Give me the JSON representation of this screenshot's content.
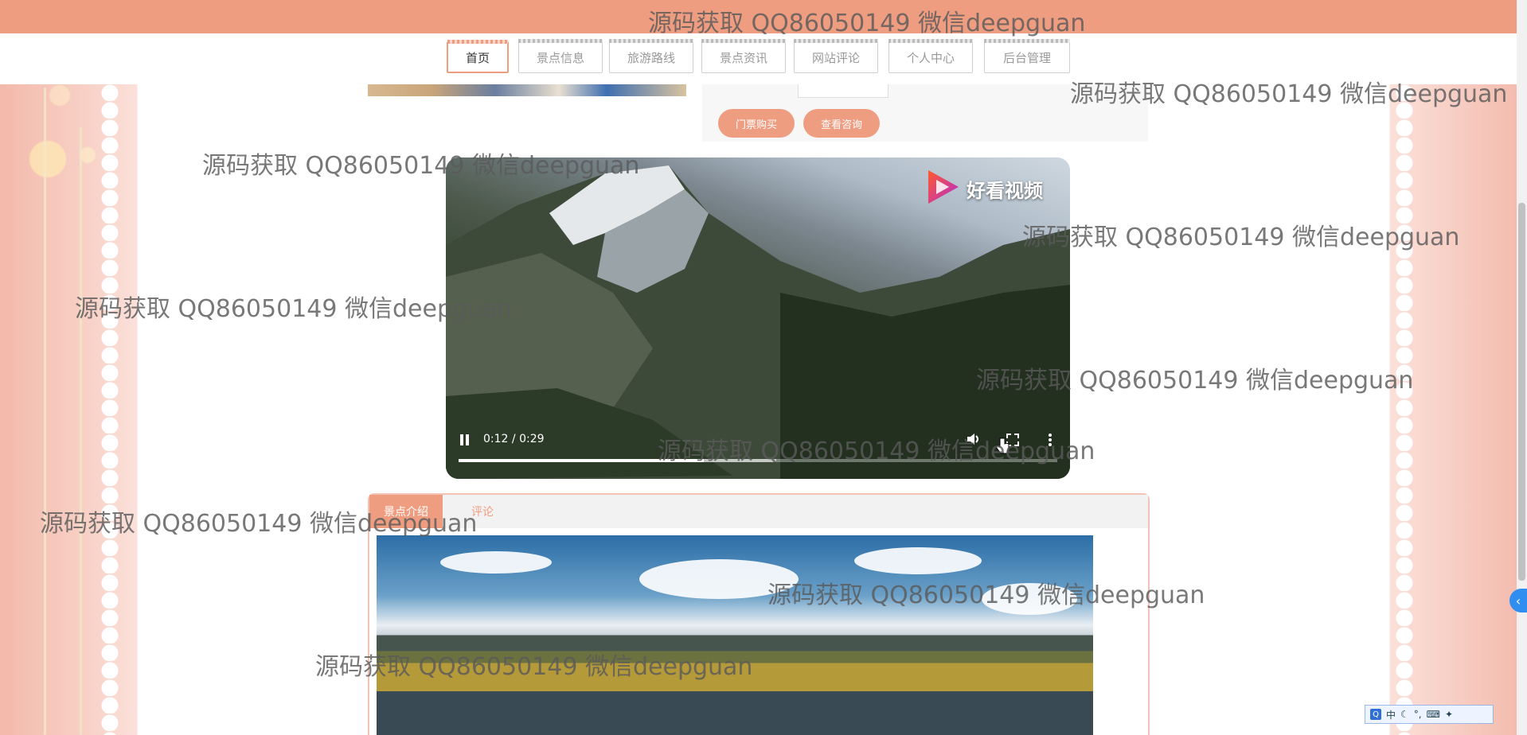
{
  "nav": {
    "items": [
      {
        "label": "首页",
        "active": true
      },
      {
        "label": "景点信息"
      },
      {
        "label": "旅游路线"
      },
      {
        "label": "景点资讯"
      },
      {
        "label": "网站评论"
      },
      {
        "label": "个人中心"
      },
      {
        "label": "后台管理"
      }
    ]
  },
  "detail": {
    "buy_button": "门票购买",
    "consult_button": "查看咨询"
  },
  "video": {
    "current_time": "0:12",
    "separator": "/",
    "duration": "0:29",
    "brand": "好看视频",
    "progress_fraction": 0.41,
    "buffered_fraction": 0.53
  },
  "tabs": {
    "intro": "景点介绍",
    "comments": "评论"
  },
  "watermark": {
    "text": "源码获取 QQ86050149 微信deepguan"
  },
  "ime": {
    "mode": "中"
  },
  "colors": {
    "accent": "#ef9d81",
    "page_bg": "#f6c9bd",
    "scroll_toggle": "#2f8ef0"
  },
  "icons": [
    "pause-icon",
    "volume-icon",
    "fullscreen-icon",
    "more-vert-icon",
    "chevron-left-icon"
  ]
}
